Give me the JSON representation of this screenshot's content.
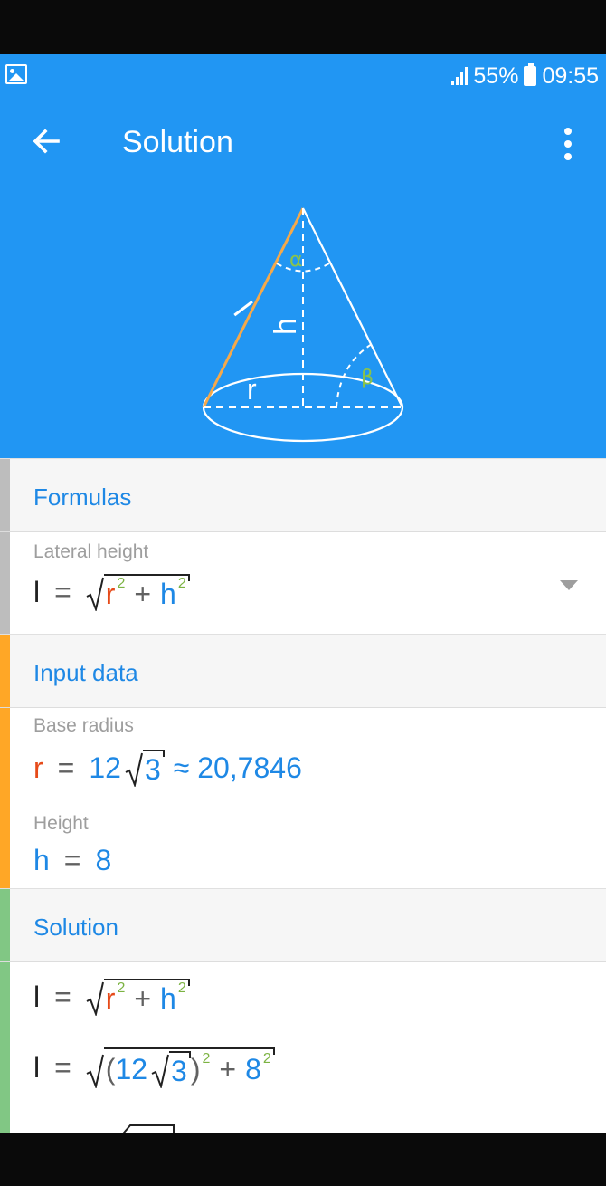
{
  "status_bar": {
    "battery_percent": "55%",
    "time": "09:55"
  },
  "app_bar": {
    "title": "Solution"
  },
  "diagram": {
    "labels": {
      "slant": "l",
      "height": "h",
      "radius": "r",
      "alpha": "α",
      "beta": "β"
    },
    "colors": {
      "slant": "#F5A94A",
      "angle": "#8BC34A",
      "lines": "#FFFFFF"
    }
  },
  "formulas": {
    "header": "Formulas",
    "bar_color": "#BDBDBD",
    "lateral_height_label": "Lateral height",
    "l": "l",
    "eq": "=",
    "r": "r",
    "h": "h",
    "plus": "+",
    "exp": "2"
  },
  "input_data": {
    "header": "Input data",
    "bar_color": "#FFA726",
    "base_radius_label": "Base radius",
    "r": "r",
    "eq": "=",
    "coef": "12",
    "radicand": "3",
    "approx": "≈ 20,7846",
    "height_label": "Height",
    "h": "h",
    "h_value": "8"
  },
  "solution": {
    "header": "Solution",
    "bar_color": "#81C784",
    "l": "l",
    "eq": "=",
    "r": "r",
    "h": "h",
    "plus": "+",
    "exp": "2",
    "open_paren": "(",
    "close_paren": ")",
    "coef": "12",
    "radicand": "3",
    "h_value": "8"
  }
}
